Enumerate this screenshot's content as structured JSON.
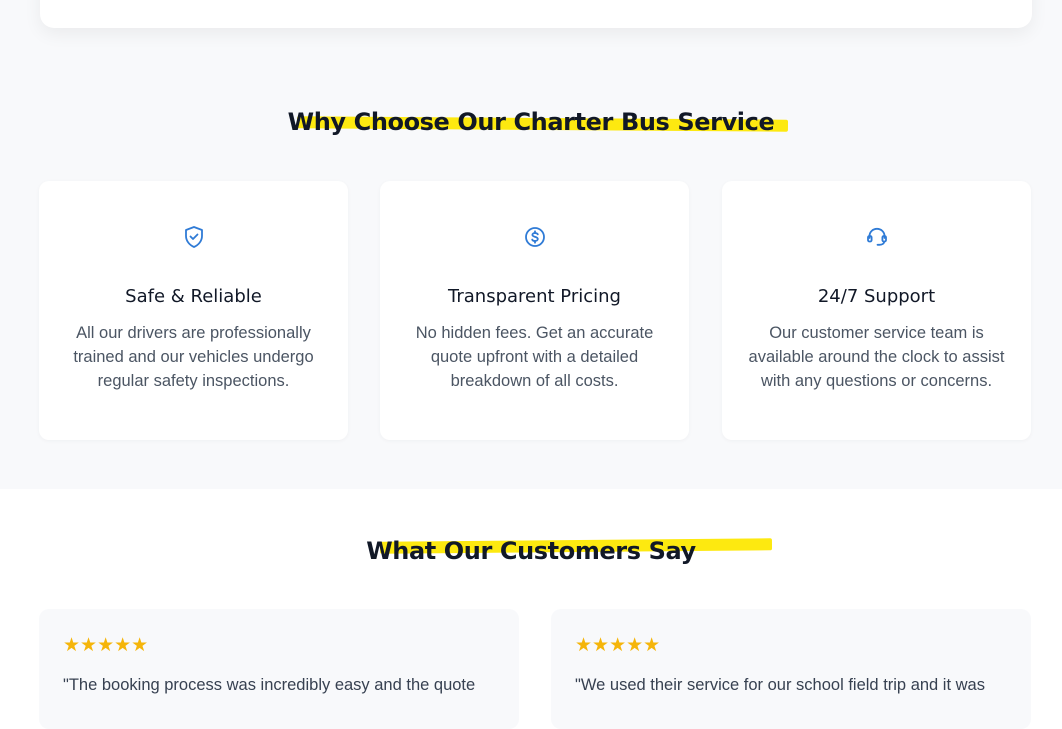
{
  "why_section": {
    "title": "Why Choose Our Charter Bus Service",
    "features": [
      {
        "icon": "shield-check-icon",
        "title": "Safe & Reliable",
        "description": "All our drivers are professionally trained and our vehicles undergo regular safety inspections."
      },
      {
        "icon": "dollar-circle-icon",
        "title": "Transparent Pricing",
        "description": "No hidden fees. Get an accurate quote upfront with a detailed breakdown of all costs."
      },
      {
        "icon": "headset-icon",
        "title": "24/7 Support",
        "description": "Our customer service team is available around the clock to assist with any questions or concerns."
      }
    ]
  },
  "testimonials": {
    "title": "What Our Customers Say",
    "reviews": [
      {
        "rating": 5,
        "stars": "★★★★★",
        "quote": "\"The booking process was incredibly easy and the quote"
      },
      {
        "rating": 5,
        "stars": "★★★★★",
        "quote": "\"We used their service for our school field trip and it was"
      }
    ]
  },
  "colors": {
    "accent_blue": "#2f7bd6",
    "highlight_yellow": "#fde910",
    "star_gold": "#f5b50a",
    "section_bg": "#f8f9fb"
  }
}
